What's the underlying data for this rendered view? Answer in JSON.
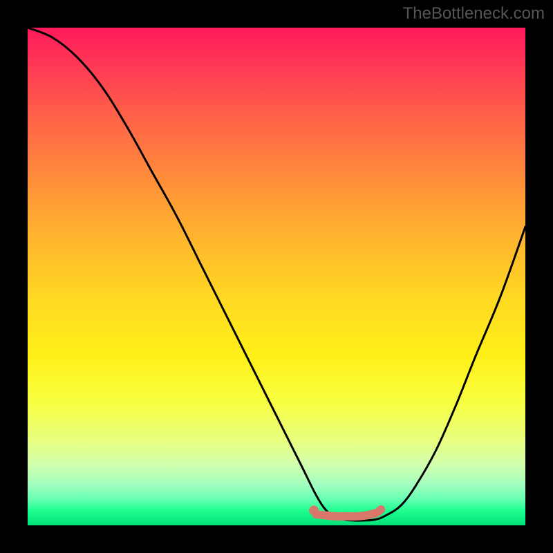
{
  "watermark": "TheBottleneck.com",
  "chart_data": {
    "type": "line",
    "title": "",
    "xlabel": "",
    "ylabel": "",
    "xlim": [
      0,
      100
    ],
    "ylim": [
      0,
      100
    ],
    "series": [
      {
        "name": "bottleneck-curve",
        "x": [
          0,
          5,
          10,
          15,
          20,
          25,
          30,
          35,
          40,
          45,
          50,
          55,
          58,
          60,
          62,
          65,
          68,
          70,
          72,
          75,
          78,
          82,
          86,
          90,
          95,
          100
        ],
        "y": [
          100,
          98,
          94,
          88,
          80,
          71,
          62,
          52,
          42,
          32,
          22,
          12,
          6,
          3,
          1.5,
          1,
          1,
          1.2,
          2,
          4,
          8,
          15,
          24,
          34,
          46,
          60
        ]
      },
      {
        "name": "highlight-segment",
        "x": [
          58,
          60,
          62,
          64,
          66,
          68,
          70,
          71
        ],
        "y": [
          2.2,
          2.0,
          1.8,
          1.8,
          1.8,
          2.0,
          2.5,
          3.2
        ]
      }
    ],
    "highlight_dot": {
      "x": 57.5,
      "y": 3.0
    },
    "colors": {
      "curve": "#000000",
      "highlight": "#d9776b",
      "gradient_top": "#ff1a5c",
      "gradient_bottom": "#00e078"
    }
  }
}
